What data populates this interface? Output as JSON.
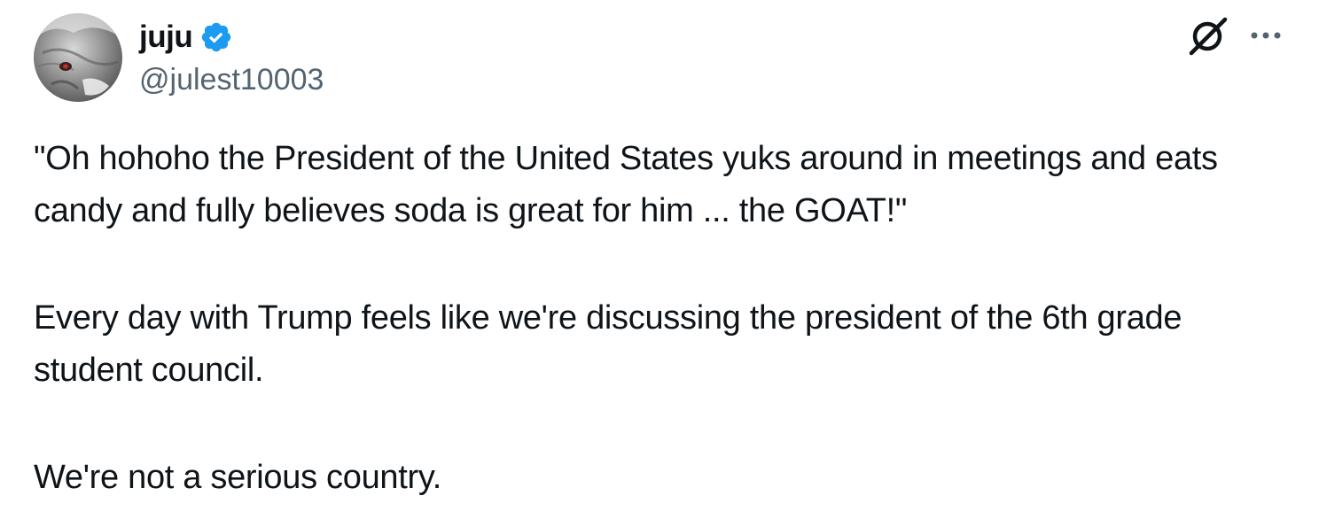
{
  "author": {
    "display_name": "juju",
    "handle": "@julest10003",
    "verified": true,
    "verified_color": "#1d9bf0",
    "avatar_icon": "cat-avatar"
  },
  "header_actions": {
    "grok_icon": "grok-slash-icon",
    "more_icon": "more-dots-icon"
  },
  "tweet": {
    "paragraphs": [
      "\"Oh hohoho the President of the United States yuks around in meetings and eats candy and fully believes soda is great for him ... the GOAT!\"",
      "Every day with Trump feels like we're discussing the president of the 6th grade student council.",
      "We're not a serious country."
    ]
  },
  "colors": {
    "text_primary": "#0f1419",
    "text_secondary": "#536471",
    "background": "#ffffff"
  }
}
